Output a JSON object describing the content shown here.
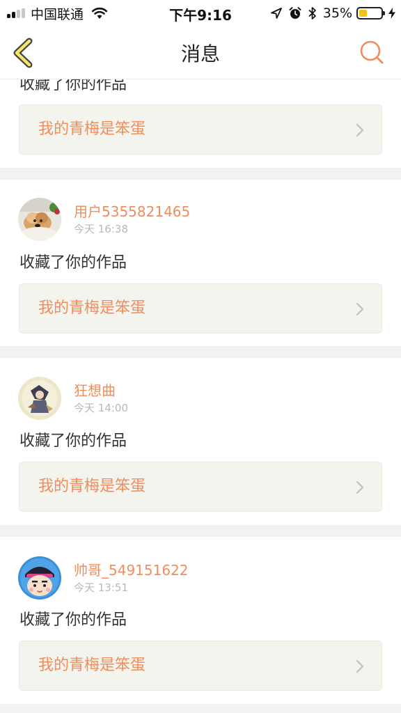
{
  "status_bar": {
    "carrier": "中国联通",
    "time": "下午9:16",
    "battery_percent": "35%",
    "battery_level": 0.35,
    "signal_bars_active": 2,
    "signal_bars_total": 4
  },
  "nav": {
    "title": "消息",
    "back_icon": "chevron-left-icon",
    "search_icon": "search-icon",
    "accent_color": "#f08d5b"
  },
  "notifications": [
    {
      "username": "",
      "timestamp": "",
      "action": "收藏了你的作品",
      "work_title": "我的青梅是笨蛋",
      "partially_visible": true
    },
    {
      "username": "用户5355821465",
      "timestamp": "今天 16:38",
      "action": "收藏了你的作品",
      "work_title": "我的青梅是笨蛋",
      "avatar": "dog-photo-avatar"
    },
    {
      "username": "狂想曲",
      "timestamp": "今天 14:00",
      "action": "收藏了你的作品",
      "work_title": "我的青梅是笨蛋",
      "avatar": "illustration-avatar"
    },
    {
      "username": "帅哥_549151622",
      "timestamp": "今天 13:51",
      "action": "收藏了你的作品",
      "work_title": "我的青梅是笨蛋",
      "avatar": "cartoon-boy-avatar"
    }
  ]
}
